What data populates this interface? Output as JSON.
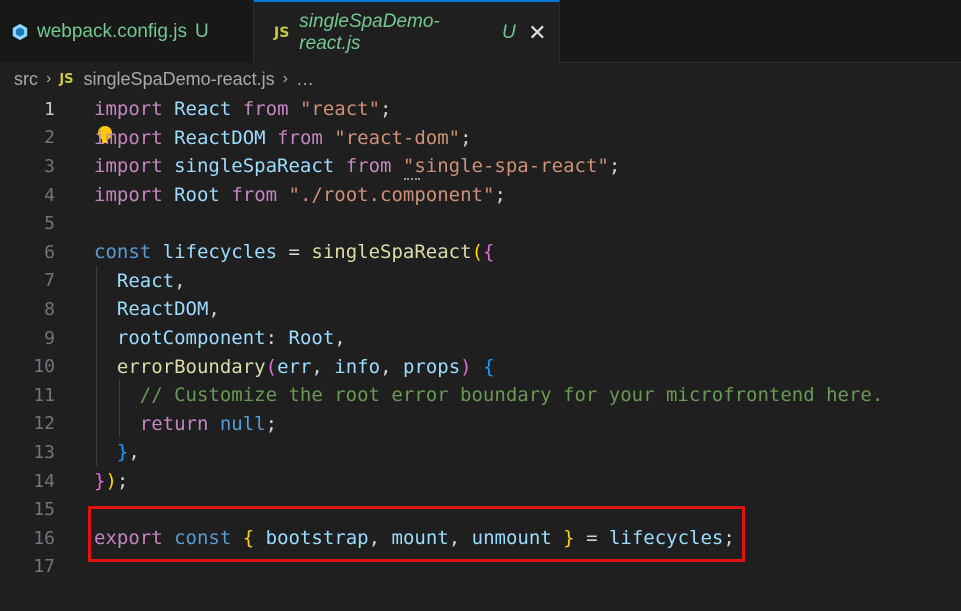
{
  "tabs": [
    {
      "label": "webpack.config.js",
      "status": "U",
      "icon": "webpack-icon",
      "active": false
    },
    {
      "label": "singleSpaDemo-react.js",
      "status": "U",
      "icon": "js-icon",
      "badge": "JS",
      "active": true,
      "close": "✕"
    }
  ],
  "breadcrumb": {
    "folder": "src",
    "badge": "JS",
    "file": "singleSpaDemo-react.js",
    "more": "…",
    "separator": "›"
  },
  "editor": {
    "line_numbers": [
      "1",
      "2",
      "3",
      "4",
      "5",
      "6",
      "7",
      "8",
      "9",
      "10",
      "11",
      "12",
      "13",
      "14",
      "15",
      "16",
      "17"
    ],
    "active_line": "1",
    "lines": [
      "import React from \"react\";",
      "import ReactDOM from \"react-dom\";",
      "import singleSpaReact from \"single-spa-react\";",
      "import Root from \"./root.component\";",
      "",
      "const lifecycles = singleSpaReact({",
      "  React,",
      "  ReactDOM,",
      "  rootComponent: Root,",
      "  errorBoundary(err, info, props) {",
      "    // Customize the root error boundary for your microfrontend here.",
      "    return null;",
      "  },",
      "});",
      "",
      "export const { bootstrap, mount, unmount } = lifecycles;",
      ""
    ]
  },
  "colors": {
    "highlight": "#e0140f",
    "accent": "#0078d4",
    "keyword": "#c586c0",
    "variable": "#9cdcfe",
    "string": "#ce9178",
    "comment": "#6a9955"
  }
}
